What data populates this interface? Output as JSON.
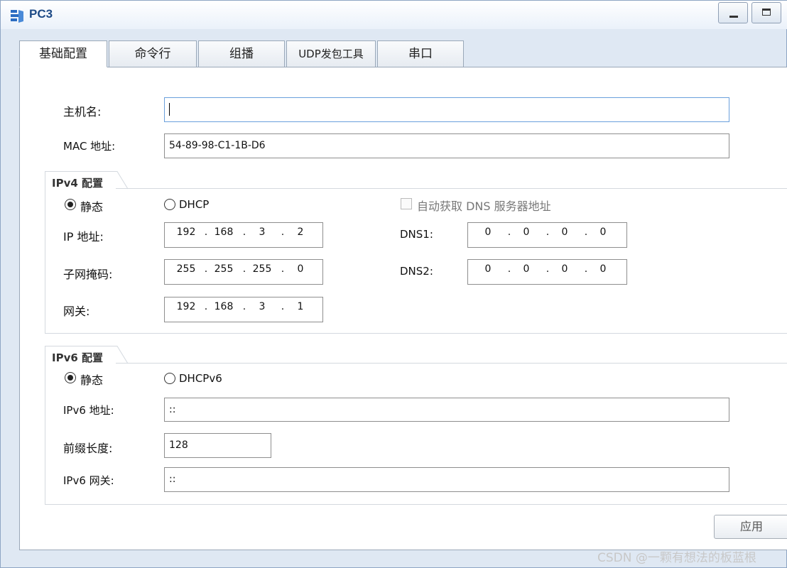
{
  "window": {
    "title": "PC3"
  },
  "tabs": [
    {
      "label": "基础配置",
      "active": true
    },
    {
      "label": "命令行",
      "active": false
    },
    {
      "label": "组播",
      "active": false
    },
    {
      "label": "UDP发包工具",
      "active": false
    },
    {
      "label": "串口",
      "active": false
    }
  ],
  "host": {
    "hostname_label": "主机名:",
    "hostname_value": "",
    "mac_label": "MAC 地址:",
    "mac_value": "54-89-98-C1-1B-D6"
  },
  "ipv4": {
    "title": "IPv4 配置",
    "static_label": "静态",
    "dhcp_label": "DHCP",
    "selected_mode": "static",
    "auto_dns_label": "自动获取 DNS 服务器地址",
    "auto_dns_checked": false,
    "ip_label": "IP 地址:",
    "ip": [
      "192",
      "168",
      "3",
      "2"
    ],
    "mask_label": "子网掩码:",
    "mask": [
      "255",
      "255",
      "255",
      "0"
    ],
    "gateway_label": "网关:",
    "gateway": [
      "192",
      "168",
      "3",
      "1"
    ],
    "dns1_label": "DNS1:",
    "dns1": [
      "0",
      "0",
      "0",
      "0"
    ],
    "dns2_label": "DNS2:",
    "dns2": [
      "0",
      "0",
      "0",
      "0"
    ]
  },
  "ipv6": {
    "title": "IPv6 配置",
    "static_label": "静态",
    "dhcp_label": "DHCPv6",
    "selected_mode": "static",
    "address_label": "IPv6 地址:",
    "address_value": "::",
    "prefix_label": "前缀长度:",
    "prefix_value": "128",
    "gateway_label": "IPv6 网关:",
    "gateway_value": "::"
  },
  "actions": {
    "apply_label": "应用"
  },
  "watermark": "CSDN @一颗有想法的板蓝根",
  "colors": {
    "title_text": "#1d4a86",
    "window_frame": "#dfe8f3",
    "focus_border": "#6aa0dc"
  },
  "icons": {
    "app": "network-pc-icon",
    "minimize": "minimize-icon",
    "maximize": "maximize-icon"
  }
}
